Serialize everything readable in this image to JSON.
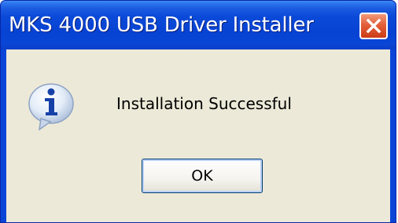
{
  "window": {
    "title": "MKS 4000 USB Driver Installer"
  },
  "titlebar": {
    "close_icon": "close-icon"
  },
  "dialog": {
    "icon": "info-icon",
    "message": "Installation Successful",
    "ok_label": "OK"
  },
  "colors": {
    "titlebar": "#0a46d6",
    "body": "#ece9d8",
    "close_button": "#e2603a"
  }
}
